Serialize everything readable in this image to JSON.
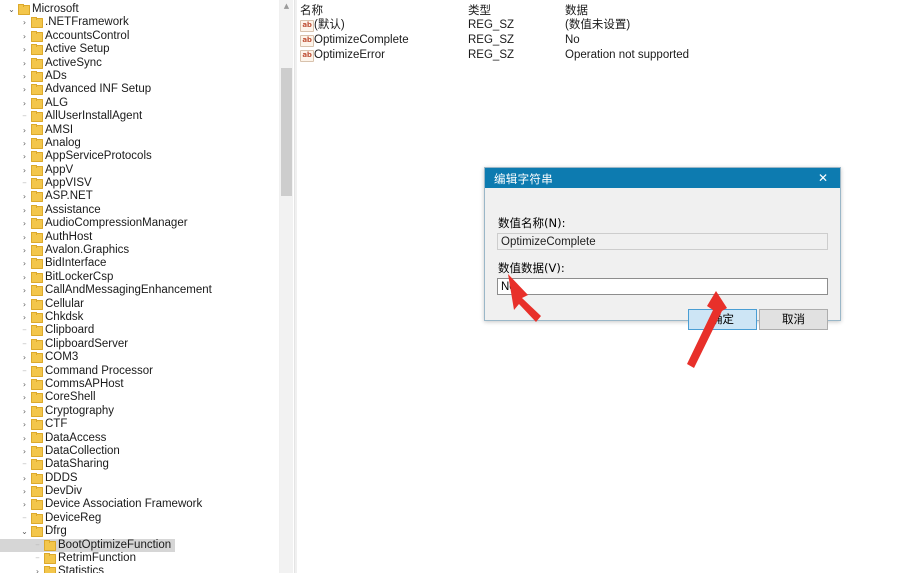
{
  "app": {
    "name": "registry-editor",
    "accent_titlebar": "#0d7bb0",
    "selection_color": "#d6d6d6",
    "arrow_color": "#e8302a"
  },
  "tree": {
    "scrollbar": {
      "up_arrow": "▲",
      "thumb_label": "scroll-thumb"
    },
    "items": [
      {
        "label": "Microsoft",
        "indent": 0,
        "twisty": "expanded"
      },
      {
        "label": ".NETFramework",
        "indent": 1,
        "twisty": "collapsed"
      },
      {
        "label": "AccountsControl",
        "indent": 1,
        "twisty": "collapsed"
      },
      {
        "label": "Active Setup",
        "indent": 1,
        "twisty": "collapsed"
      },
      {
        "label": "ActiveSync",
        "indent": 1,
        "twisty": "collapsed"
      },
      {
        "label": "ADs",
        "indent": 1,
        "twisty": "collapsed"
      },
      {
        "label": "Advanced INF Setup",
        "indent": 1,
        "twisty": "collapsed"
      },
      {
        "label": "ALG",
        "indent": 1,
        "twisty": "collapsed"
      },
      {
        "label": "AllUserInstallAgent",
        "indent": 1,
        "twisty": "none"
      },
      {
        "label": "AMSI",
        "indent": 1,
        "twisty": "collapsed"
      },
      {
        "label": "Analog",
        "indent": 1,
        "twisty": "collapsed"
      },
      {
        "label": "AppServiceProtocols",
        "indent": 1,
        "twisty": "collapsed"
      },
      {
        "label": "AppV",
        "indent": 1,
        "twisty": "collapsed"
      },
      {
        "label": "AppVISV",
        "indent": 1,
        "twisty": "none"
      },
      {
        "label": "ASP.NET",
        "indent": 1,
        "twisty": "collapsed"
      },
      {
        "label": "Assistance",
        "indent": 1,
        "twisty": "collapsed"
      },
      {
        "label": "AudioCompressionManager",
        "indent": 1,
        "twisty": "collapsed"
      },
      {
        "label": "AuthHost",
        "indent": 1,
        "twisty": "collapsed"
      },
      {
        "label": "Avalon.Graphics",
        "indent": 1,
        "twisty": "collapsed"
      },
      {
        "label": "BidInterface",
        "indent": 1,
        "twisty": "collapsed"
      },
      {
        "label": "BitLockerCsp",
        "indent": 1,
        "twisty": "collapsed"
      },
      {
        "label": "CallAndMessagingEnhancement",
        "indent": 1,
        "twisty": "collapsed"
      },
      {
        "label": "Cellular",
        "indent": 1,
        "twisty": "collapsed"
      },
      {
        "label": "Chkdsk",
        "indent": 1,
        "twisty": "collapsed"
      },
      {
        "label": "Clipboard",
        "indent": 1,
        "twisty": "none"
      },
      {
        "label": "ClipboardServer",
        "indent": 1,
        "twisty": "none"
      },
      {
        "label": "COM3",
        "indent": 1,
        "twisty": "collapsed"
      },
      {
        "label": "Command Processor",
        "indent": 1,
        "twisty": "none"
      },
      {
        "label": "CommsAPHost",
        "indent": 1,
        "twisty": "collapsed"
      },
      {
        "label": "CoreShell",
        "indent": 1,
        "twisty": "collapsed"
      },
      {
        "label": "Cryptography",
        "indent": 1,
        "twisty": "collapsed"
      },
      {
        "label": "CTF",
        "indent": 1,
        "twisty": "collapsed"
      },
      {
        "label": "DataAccess",
        "indent": 1,
        "twisty": "collapsed"
      },
      {
        "label": "DataCollection",
        "indent": 1,
        "twisty": "collapsed"
      },
      {
        "label": "DataSharing",
        "indent": 1,
        "twisty": "none"
      },
      {
        "label": "DDDS",
        "indent": 1,
        "twisty": "collapsed"
      },
      {
        "label": "DevDiv",
        "indent": 1,
        "twisty": "collapsed"
      },
      {
        "label": "Device Association Framework",
        "indent": 1,
        "twisty": "collapsed"
      },
      {
        "label": "DeviceReg",
        "indent": 1,
        "twisty": "none"
      },
      {
        "label": "Dfrg",
        "indent": 1,
        "twisty": "expanded"
      },
      {
        "label": "BootOptimizeFunction",
        "indent": 2,
        "twisty": "none",
        "selected": true
      },
      {
        "label": "RetrimFunction",
        "indent": 2,
        "twisty": "none"
      },
      {
        "label": "Statistics",
        "indent": 2,
        "twisty": "collapsed"
      }
    ]
  },
  "values": {
    "columns": {
      "name": "名称",
      "type": "类型",
      "data": "数据"
    },
    "icon_label": "ab",
    "rows": [
      {
        "name": "(默认)",
        "type": "REG_SZ",
        "data": "(数值未设置)"
      },
      {
        "name": "OptimizeComplete",
        "type": "REG_SZ",
        "data": "No"
      },
      {
        "name": "OptimizeError",
        "type": "REG_SZ",
        "data": "Operation not supported"
      }
    ]
  },
  "dialog": {
    "title": "编辑字符串",
    "close_icon": "✕",
    "name_label": "数值名称(N):",
    "name_value": "OptimizeComplete",
    "data_label": "数值数据(V):",
    "data_value": "No",
    "ok_label": "确定",
    "cancel_label": "取消"
  },
  "annotations": {
    "arrow_to_data_field": "red-arrow-pointing-to-value-data-input",
    "arrow_to_ok_button": "red-arrow-pointing-to-ok-button"
  }
}
